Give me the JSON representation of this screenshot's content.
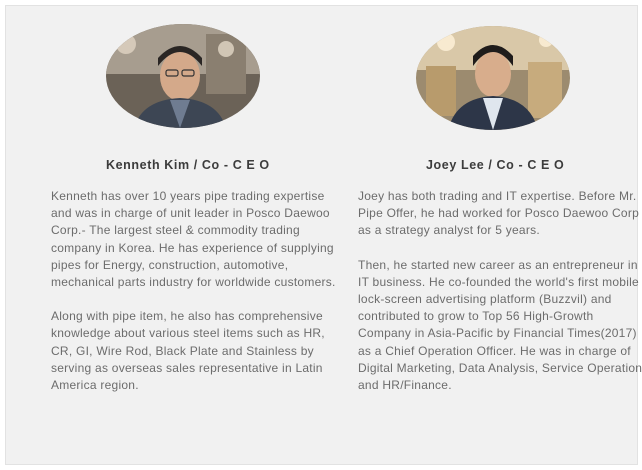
{
  "people": [
    {
      "name": "Kenneth Kim",
      "separator": "/",
      "role": "Co - C E O",
      "paragraphs": [
        "Kenneth has over 10 years pipe trading expertise and was in charge of unit leader in Posco Daewoo Corp.- The largest steel & commodity trading company in Korea. He has experience of supplying pipes for Energy, construction, automotive, mechanical parts industry for worldwide customers.",
        "Along with pipe item, he also has comprehensive knowledge about various steel items such as HR, CR, GI, Wire Rod, Black Plate and Stainless by serving as overseas sales representative in Latin America region."
      ]
    },
    {
      "name": "Joey Lee",
      "separator": "/",
      "role": "Co - C E O",
      "paragraphs": [
        "Joey has both trading and IT expertise. Before Mr. Pipe Offer, he had worked for Posco Daewoo Corp as a strategy analyst for 5 years.",
        "Then, he started new career as an entrepreneur in IT business. He co-founded the world's first mobile lock-screen advertising platform (Buzzvil) and contributed to grow to Top 56 High-Growth Company in Asia-Pacific by Financial Times(2017) as a Chief Operation Officer. He was in charge of Digital Marketing, Data Analysis, Service Operation and HR/Finance."
      ]
    }
  ]
}
